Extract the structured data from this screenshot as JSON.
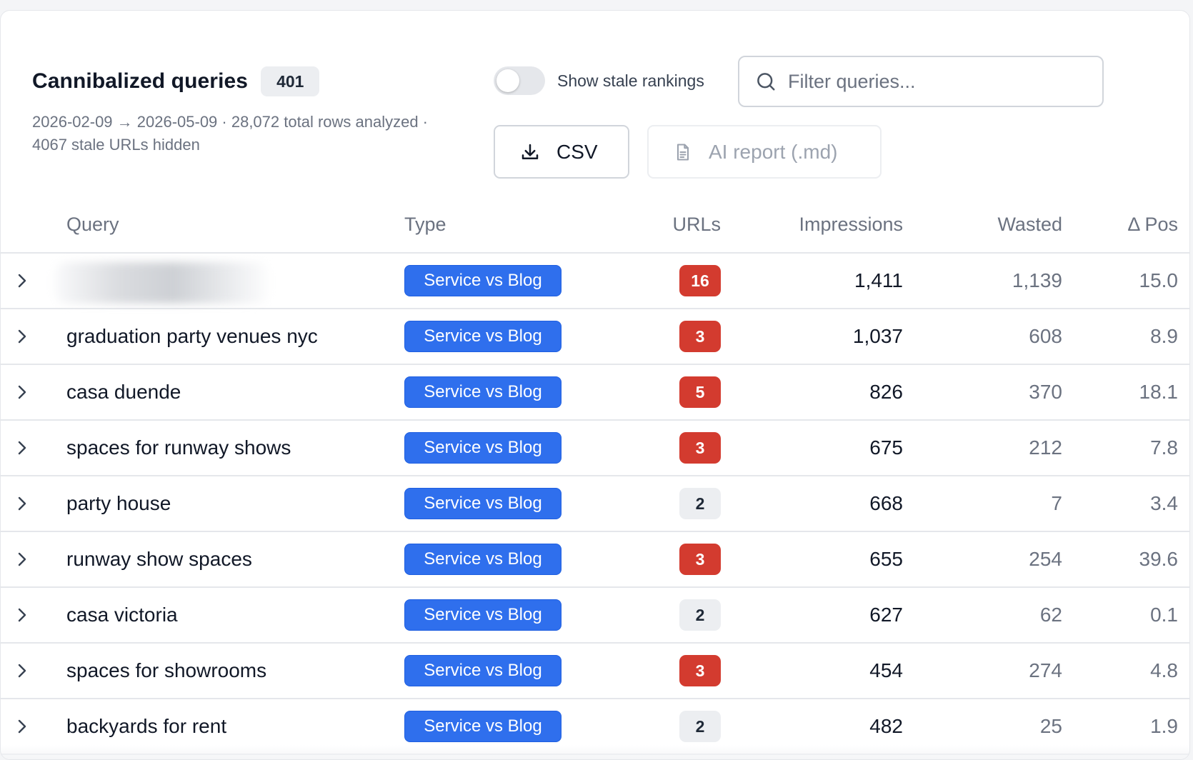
{
  "header": {
    "title": "Cannibalized queries",
    "count": "401",
    "subtitle": "2026-02-09 → 2026-05-09 · 28,072 total rows analyzed · 4067 stale URLs hidden"
  },
  "toolbar": {
    "toggle_label": "Show stale rankings",
    "toggle_on": false,
    "search_placeholder": "Filter queries...",
    "csv_label": "CSV",
    "ai_report_label": "AI report (.md)"
  },
  "table": {
    "columns": {
      "query": "Query",
      "type": "Type",
      "urls": "URLs",
      "impressions": "Impressions",
      "wasted": "Wasted",
      "delta_pos": "Δ Pos"
    },
    "rows": [
      {
        "query": "",
        "redacted": true,
        "type": "Service vs Blog",
        "urls": "16",
        "urls_level": "hot",
        "impressions": "1,411",
        "wasted": "1,139",
        "delta_pos": "15.0"
      },
      {
        "query": "graduation party venues nyc",
        "redacted": false,
        "type": "Service vs Blog",
        "urls": "3",
        "urls_level": "hot",
        "impressions": "1,037",
        "wasted": "608",
        "delta_pos": "8.9"
      },
      {
        "query": "casa duende",
        "redacted": false,
        "type": "Service vs Blog",
        "urls": "5",
        "urls_level": "hot",
        "impressions": "826",
        "wasted": "370",
        "delta_pos": "18.1"
      },
      {
        "query": "spaces for runway shows",
        "redacted": false,
        "type": "Service vs Blog",
        "urls": "3",
        "urls_level": "hot",
        "impressions": "675",
        "wasted": "212",
        "delta_pos": "7.8"
      },
      {
        "query": "party house",
        "redacted": false,
        "type": "Service vs Blog",
        "urls": "2",
        "urls_level": "cool",
        "impressions": "668",
        "wasted": "7",
        "delta_pos": "3.4"
      },
      {
        "query": "runway show spaces",
        "redacted": false,
        "type": "Service vs Blog",
        "urls": "3",
        "urls_level": "hot",
        "impressions": "655",
        "wasted": "254",
        "delta_pos": "39.6"
      },
      {
        "query": "casa victoria",
        "redacted": false,
        "type": "Service vs Blog",
        "urls": "2",
        "urls_level": "cool",
        "impressions": "627",
        "wasted": "62",
        "delta_pos": "0.1"
      },
      {
        "query": "spaces for showrooms",
        "redacted": false,
        "type": "Service vs Blog",
        "urls": "3",
        "urls_level": "hot",
        "impressions": "454",
        "wasted": "274",
        "delta_pos": "4.8"
      },
      {
        "query": "backyards for rent",
        "redacted": false,
        "type": "Service vs Blog",
        "urls": "2",
        "urls_level": "cool",
        "impressions": "482",
        "wasted": "25",
        "delta_pos": "1.9"
      }
    ]
  },
  "colors": {
    "type_pill": "#2f6fed",
    "urls_hot": "#d33b2f",
    "urls_cool": "#eceef1"
  },
  "icons": {
    "search": "search-icon",
    "download": "download-icon",
    "document": "document-icon",
    "chevron": "chevron-right-icon"
  }
}
